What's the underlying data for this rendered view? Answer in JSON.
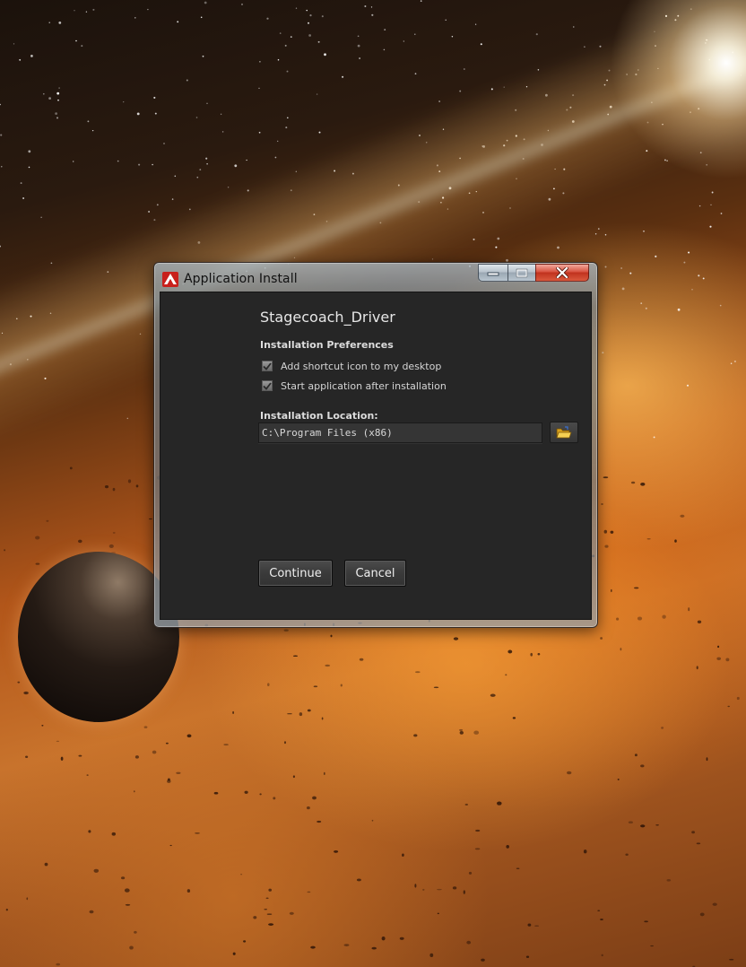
{
  "window": {
    "title": "Application Install",
    "buttons": {
      "minimize_icon": "minimize-icon",
      "maximize_icon": "maximize-icon",
      "close_icon": "close-icon"
    }
  },
  "installer": {
    "app_name": "Stagecoach_Driver",
    "preferences_heading": "Installation Preferences",
    "options": [
      {
        "label": "Add shortcut icon to my desktop",
        "checked": true
      },
      {
        "label": "Start application after installation",
        "checked": true
      }
    ],
    "location_label": "Installation Location:",
    "location_value": "C:\\Program Files (x86)",
    "browse_icon": "folder-icon",
    "continue_label": "Continue",
    "cancel_label": "Cancel"
  },
  "colors": {
    "client_background": "#262626",
    "close_button": "#c0321e",
    "app_icon_red": "#c8201c"
  }
}
